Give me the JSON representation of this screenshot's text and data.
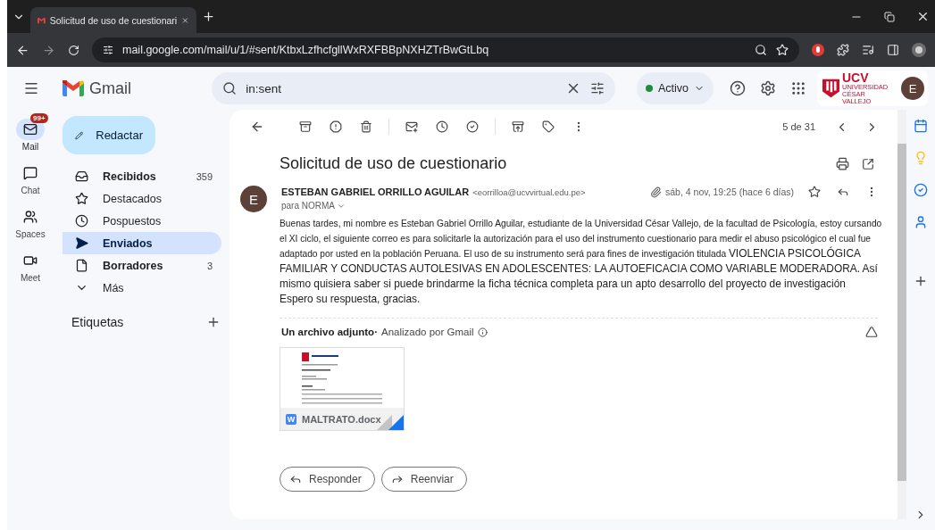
{
  "browser": {
    "tabs": [
      {
        "title": "Solicitud de uso de cuestionari",
        "selected": true
      }
    ],
    "url": "mail.google.com/mail/u/1/#sent/KtbxLzfhcfgllWxRXFBBpNXHZTrBwGtLbq"
  },
  "app": {
    "name": "Gmail"
  },
  "search": {
    "value": "in:sent"
  },
  "status": {
    "label": "Activo"
  },
  "account": {
    "org": "UCV",
    "org_subtitle": "UNIVERSIDAD CÉSAR VALLEJO",
    "avatar": "E"
  },
  "rail": [
    {
      "kind": "mail",
      "label": "Mail",
      "badge": "99+",
      "selected": true
    },
    {
      "kind": "chat",
      "label": "Chat",
      "selected": false
    },
    {
      "kind": "spaces",
      "label": "Spaces",
      "selected": false
    },
    {
      "kind": "meet",
      "label": "Meet",
      "selected": false
    }
  ],
  "compose": {
    "label": "Redactar"
  },
  "folders": [
    {
      "kind": "inbox",
      "label": "Recibidos",
      "count": "359",
      "unread": true,
      "selected": false
    },
    {
      "kind": "starred",
      "label": "Destacados",
      "unread": false,
      "selected": false
    },
    {
      "kind": "snoozed",
      "label": "Pospuestos",
      "unread": false,
      "selected": false
    },
    {
      "kind": "sent",
      "label": "Enviados",
      "unread": true,
      "selected": true
    },
    {
      "kind": "drafts",
      "label": "Borradores",
      "count": "3",
      "unread": true,
      "selected": false
    },
    {
      "kind": "more",
      "label": "Más",
      "unread": false,
      "selected": false
    }
  ],
  "labels_heading": "Etiquetas",
  "pager": "5 de 31",
  "message": {
    "subject": "Solicitud de uso de cuestionario",
    "avatar": "E",
    "sender_name": "ESTEBAN GABRIEL ORRILLO AGUILAR",
    "sender_email": "<eorrilloa@ucvvirtual.edu.pe>",
    "recipient": "para NORMA",
    "date": "sáb, 4 nov, 19:25 (hace 6 días)",
    "body": [
      [
        {
          "kind": "pasted",
          "text": "Buenas tardes, mi nombre es Esteban Gabriel Orrillo Aguilar, estudiante de la Universidad César Vallejo, de la facultad de Psicología, estoy cursando el XI ciclo, el siguiente correo es para solicitarle la autorización para el uso del instrumento cuestionario para medir el abuso psicológico el cual fue adaptado por usted en la población Peruana. El uso de su instrumento será para fines de investigación titulada "
        },
        {
          "kind": "typed",
          "text": "VIOLENCIA PSICOLÓGICA FAMILIAR Y CONDUCTAS AUTOLESIVAS EN ADOLESCENTES: LA AUTOEFICACIA COMO VARIABLE MODERADORA. Así mismo quisiera saber si puede brindarme la ficha técnica completa para un apto desarrollo del proyecto de investigación"
        }
      ],
      [
        {
          "kind": "typed",
          "text": "Espero su respuesta, gracias."
        }
      ]
    ],
    "attachments": {
      "heading": "Un archivo adjunto·",
      "scan_note": "Analizado por Gmail",
      "files": [
        {
          "name": "MALTRATO.docx",
          "icon_letter": "W"
        }
      ]
    },
    "actions": [
      {
        "kind": "reply",
        "label": "Responder"
      },
      {
        "kind": "forward",
        "label": "Reenviar"
      }
    ]
  }
}
